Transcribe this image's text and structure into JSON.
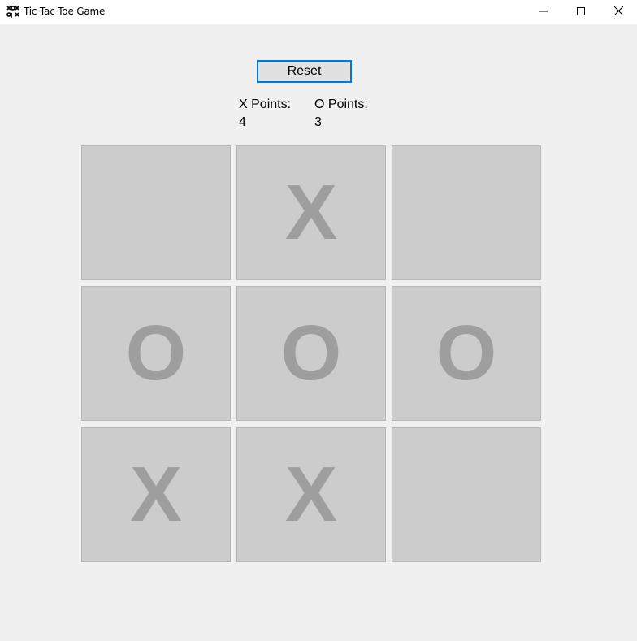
{
  "window": {
    "title": "Tic Tac Toe Game",
    "app_icon": "tic-tac-toe-icon",
    "controls": [
      "minimize-icon",
      "maximize-icon",
      "close-icon"
    ]
  },
  "toolbar": {
    "reset_label": "Reset"
  },
  "score": {
    "x_label": "X Points:",
    "x_value": "4",
    "o_label": "O Points:",
    "o_value": "3"
  },
  "board": {
    "cells": [
      "",
      "X",
      "",
      "O",
      "O",
      "O",
      "X",
      "X",
      ""
    ]
  },
  "colors": {
    "background": "#f0f0f0",
    "cell_background": "#cccccc",
    "mark": "#9e9e9e",
    "button_focus_border": "#0078d7"
  }
}
